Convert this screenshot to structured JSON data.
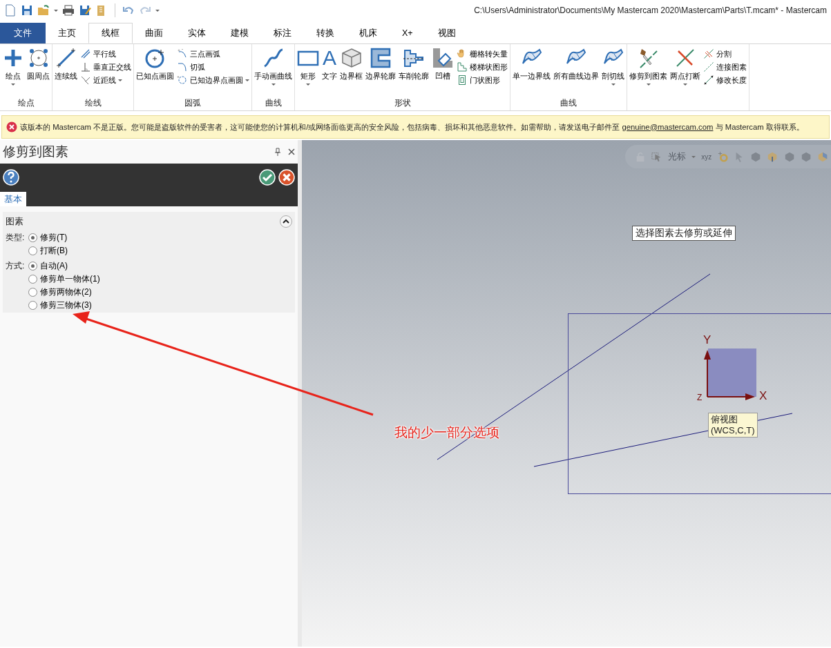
{
  "window": {
    "title": "C:\\Users\\Administrator\\Documents\\My Mastercam 2020\\Mastercam\\Parts\\T.mcam* - Mastercam"
  },
  "tabs": [
    {
      "label": "文件",
      "kind": "file",
      "selected": false
    },
    {
      "label": "主页",
      "kind": "normal",
      "selected": false
    },
    {
      "label": "线框",
      "kind": "normal",
      "selected": true
    },
    {
      "label": "曲面",
      "kind": "normal",
      "selected": false
    },
    {
      "label": "实体",
      "kind": "normal",
      "selected": false
    },
    {
      "label": "建模",
      "kind": "normal",
      "selected": false
    },
    {
      "label": "标注",
      "kind": "normal",
      "selected": false
    },
    {
      "label": "转换",
      "kind": "normal",
      "selected": false
    },
    {
      "label": "机床",
      "kind": "normal",
      "selected": false
    },
    {
      "label": "X+",
      "kind": "normal",
      "selected": false
    },
    {
      "label": "视图",
      "kind": "normal",
      "selected": false
    }
  ],
  "ribbon": {
    "groups": [
      {
        "label": "绘点",
        "items": [
          {
            "label": "绘点",
            "kind": "large",
            "dropdown": true
          },
          {
            "label": "圆周点",
            "kind": "large",
            "dropdown": false
          }
        ]
      },
      {
        "label": "绘线",
        "items": [
          {
            "label": "连续线",
            "kind": "large",
            "dropdown": false
          },
          {
            "label": "平行线",
            "kind": "small",
            "dropdown": false
          },
          {
            "label": "垂直正交线",
            "kind": "small",
            "dropdown": false
          },
          {
            "label": "近距线",
            "kind": "small",
            "dropdown": true
          }
        ]
      },
      {
        "label": "圆弧",
        "items": [
          {
            "label": "已知点画圆",
            "kind": "large",
            "dropdown": false
          },
          {
            "label": "三点画弧",
            "kind": "small",
            "dropdown": false
          },
          {
            "label": "切弧",
            "kind": "small",
            "dropdown": false
          },
          {
            "label": "已知边界点画圆",
            "kind": "small",
            "dropdown": true
          }
        ]
      },
      {
        "label": "曲线",
        "items": [
          {
            "label": "手动画曲线",
            "kind": "large",
            "dropdown": true
          }
        ]
      },
      {
        "label": "形状",
        "items": [
          {
            "label": "矩形",
            "kind": "large",
            "dropdown": true
          },
          {
            "label": "文字",
            "kind": "large",
            "dropdown": false,
            "glyph": "A"
          },
          {
            "label": "边界框",
            "kind": "large",
            "dropdown": false
          },
          {
            "label": "边界轮廓",
            "kind": "large",
            "dropdown": false
          },
          {
            "label": "车削轮廓",
            "kind": "large",
            "dropdown": false
          },
          {
            "label": "凹槽",
            "kind": "large",
            "dropdown": false
          },
          {
            "label": "栅格转矢量",
            "kind": "small",
            "dropdown": false
          },
          {
            "label": "楼梯状图形",
            "kind": "small",
            "dropdown": false
          },
          {
            "label": "门状图形",
            "kind": "small",
            "dropdown": false
          }
        ]
      },
      {
        "label": "曲线",
        "items": [
          {
            "label": "单一边界线",
            "kind": "large",
            "dropdown": false
          },
          {
            "label": "所有曲线边界",
            "kind": "large",
            "dropdown": false
          },
          {
            "label": "剖切线",
            "kind": "large",
            "dropdown": true
          }
        ]
      },
      {
        "items": [
          {
            "label": "修剪到图素",
            "kind": "large",
            "dropdown": true
          },
          {
            "label": "两点打断",
            "kind": "large",
            "dropdown": true
          },
          {
            "label": "分割",
            "kind": "small",
            "dropdown": false
          },
          {
            "label": "连接图素",
            "kind": "small",
            "dropdown": false
          },
          {
            "label": "修改长度",
            "kind": "small",
            "dropdown": false
          }
        ]
      }
    ]
  },
  "warning": {
    "before": "该版本的 Mastercam 不是正版。您可能是盗版软件的受害者，这可能使您的计算机和/或网络面临更高的安全风险，包括病毒、损坏和其他恶意软件。如需帮助，请发送电子邮件至 ",
    "link": "genuine@mastercam.com",
    "after": " 与 Mastercam 取得联系。"
  },
  "panel": {
    "title": "修剪到图素",
    "tabs": [
      {
        "label": "基本",
        "selected": true
      }
    ],
    "section": {
      "title": "图素",
      "expanded": true,
      "groups": [
        {
          "label": "类型:",
          "options": [
            {
              "label": "修剪(T)",
              "selected": true
            },
            {
              "label": "打断(B)",
              "selected": false
            }
          ]
        },
        {
          "label": "方式:",
          "options": [
            {
              "label": "自动(A)",
              "selected": true
            },
            {
              "label": "修剪单一物体(1)",
              "selected": false
            },
            {
              "label": "修剪两物体(2)",
              "selected": false
            },
            {
              "label": "修剪三物体(3)",
              "selected": false
            }
          ]
        }
      ]
    }
  },
  "viewport": {
    "toolbar": {
      "cursor_label": "光标",
      "origin_glyph": "xyz"
    },
    "prompt": "选择图素去修剪或延伸",
    "axes": {
      "y": "Y",
      "x": "X",
      "z": "Z"
    },
    "view_label": [
      "俯视图",
      "(WCS,C,T)"
    ]
  },
  "annotation": {
    "text": "我的少一部分选项"
  }
}
